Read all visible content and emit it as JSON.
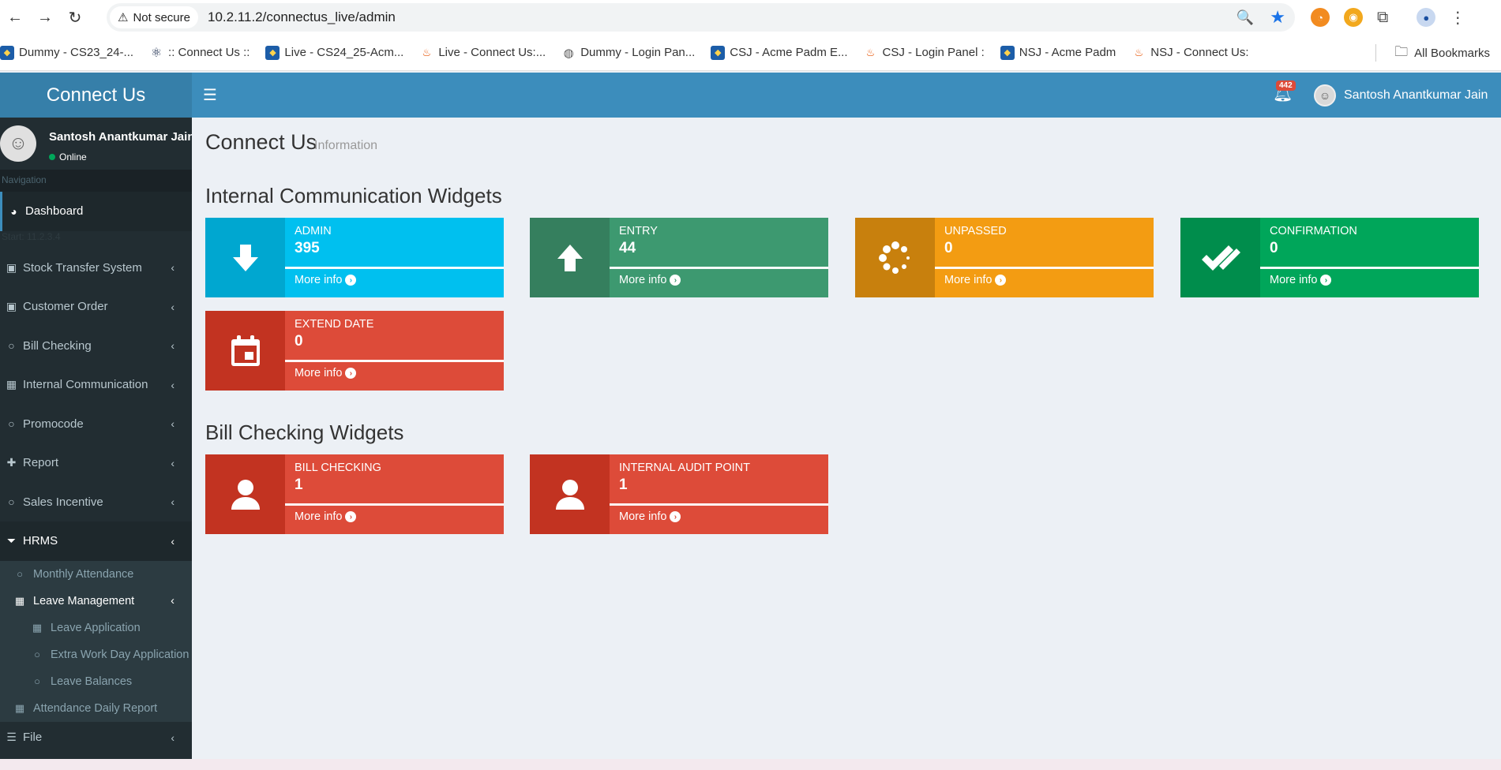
{
  "browser": {
    "security_label": "Not secure",
    "url": "10.2.11.2/connectus_live/admin",
    "bookmarks": [
      {
        "label": "Dummy  - CS23_24-...",
        "icon": "ck-favicon"
      },
      {
        "label": ":: Connect Us ::",
        "icon": "react-favicon"
      },
      {
        "label": "Live - CS24_25-Acm...",
        "icon": "ck-favicon"
      },
      {
        "label": "Live - Connect Us:...",
        "icon": "flame-favicon"
      },
      {
        "label": "Dummy - Login Pan...",
        "icon": "globe-favicon"
      },
      {
        "label": "CSJ - Acme Padm E...",
        "icon": "ck-favicon"
      },
      {
        "label": "CSJ - Login Panel :",
        "icon": "flame-favicon"
      },
      {
        "label": "NSJ - Acme Padm",
        "icon": "ck-favicon"
      },
      {
        "label": "NSJ - Connect Us:",
        "icon": "flame-favicon"
      }
    ],
    "all_bookmarks": "All Bookmarks"
  },
  "header": {
    "logo": "Connect Us",
    "notification_count": "442",
    "user_name": "Santosh Anantkumar Jain"
  },
  "sidebar": {
    "user_name": "Santosh Anantkumar Jain",
    "status": "Online",
    "nav_header": "Navigation",
    "faint_text": "Start: 11.2.3.4",
    "items": {
      "dashboard": "Dashboard",
      "stock_transfer": "Stock Transfer System",
      "customer_order": "Customer Order",
      "bill_checking": "Bill Checking",
      "internal_comm": "Internal Communication",
      "promocode": "Promocode",
      "report": "Report",
      "sales_incentive": "Sales Incentive",
      "hrms": "HRMS",
      "monthly_attendance": "Monthly Attendance",
      "leave_management": "Leave Management",
      "leave_application": "Leave Application",
      "extra_work_day": "Extra Work Day Application",
      "leave_balances": "Leave Balances",
      "attendance_daily": "Attendance Daily Report",
      "file": "File"
    }
  },
  "content": {
    "title": "Connect Us",
    "subtitle": "Information",
    "section1": "Internal Communication Widgets",
    "section2": "Bill Checking Widgets",
    "more_info": "More info",
    "widgets": {
      "admin": {
        "label": "ADMIN",
        "value": "395",
        "icon": "arrow-down-icon",
        "color_main": "#00c0ef",
        "color_icon": "#00a7d0"
      },
      "entry": {
        "label": "ENTRY",
        "value": "44",
        "icon": "arrow-up-icon",
        "color_main": "#3d9970",
        "color_icon": "#357f5e"
      },
      "unpassed": {
        "label": "UNPASSED",
        "value": "0",
        "icon": "spinner-icon",
        "color_main": "#f39c12",
        "color_icon": "#c8800d"
      },
      "confirmation": {
        "label": "CONFIRMATION",
        "value": "0",
        "icon": "double-check-icon",
        "color_main": "#00a65a",
        "color_icon": "#008d4c"
      },
      "extend_date": {
        "label": "EXTEND DATE",
        "value": "0",
        "icon": "calendar-icon",
        "color_main": "#dd4b39",
        "color_icon": "#c23321"
      },
      "bill_checking": {
        "label": "BILL CHECKING",
        "value": "1",
        "icon": "user-icon",
        "color_main": "#dd4b39",
        "color_icon": "#c23321"
      },
      "internal_audit": {
        "label": "INTERNAL AUDIT POINT",
        "value": "1",
        "icon": "user-icon",
        "color_main": "#dd4b39",
        "color_icon": "#c23321"
      }
    }
  }
}
